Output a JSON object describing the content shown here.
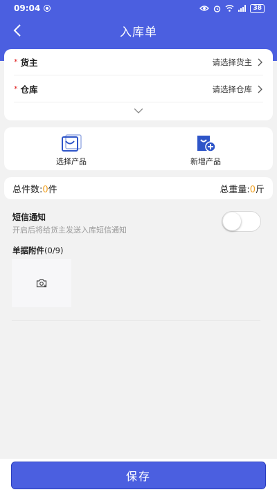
{
  "status_bar": {
    "time": "09:04",
    "battery": "38"
  },
  "nav": {
    "title": "入库单"
  },
  "form": {
    "owner": {
      "required_mark": "*",
      "label": "货主",
      "placeholder": "请选择货主"
    },
    "warehouse": {
      "required_mark": "*",
      "label": "仓库",
      "placeholder": "请选择仓库"
    }
  },
  "actions": {
    "select_product": "选择产品",
    "new_product": "新增产品"
  },
  "summary": {
    "total_count_label": "总件数:",
    "total_count_value": "0",
    "total_count_unit": "件",
    "total_weight_label": "总重量:",
    "total_weight_value": "0",
    "total_weight_unit": "斤"
  },
  "sms": {
    "title": "短信通知",
    "description": "开启后将给货主发送入库短信通知",
    "enabled": false
  },
  "attachments": {
    "label": "单据附件",
    "count": "(0/9)"
  },
  "footer": {
    "save_label": "保存"
  },
  "colors": {
    "primary": "#4b5fe0",
    "accent": "#f0a020",
    "required": "#e02020",
    "background": "#f2f2f2"
  }
}
